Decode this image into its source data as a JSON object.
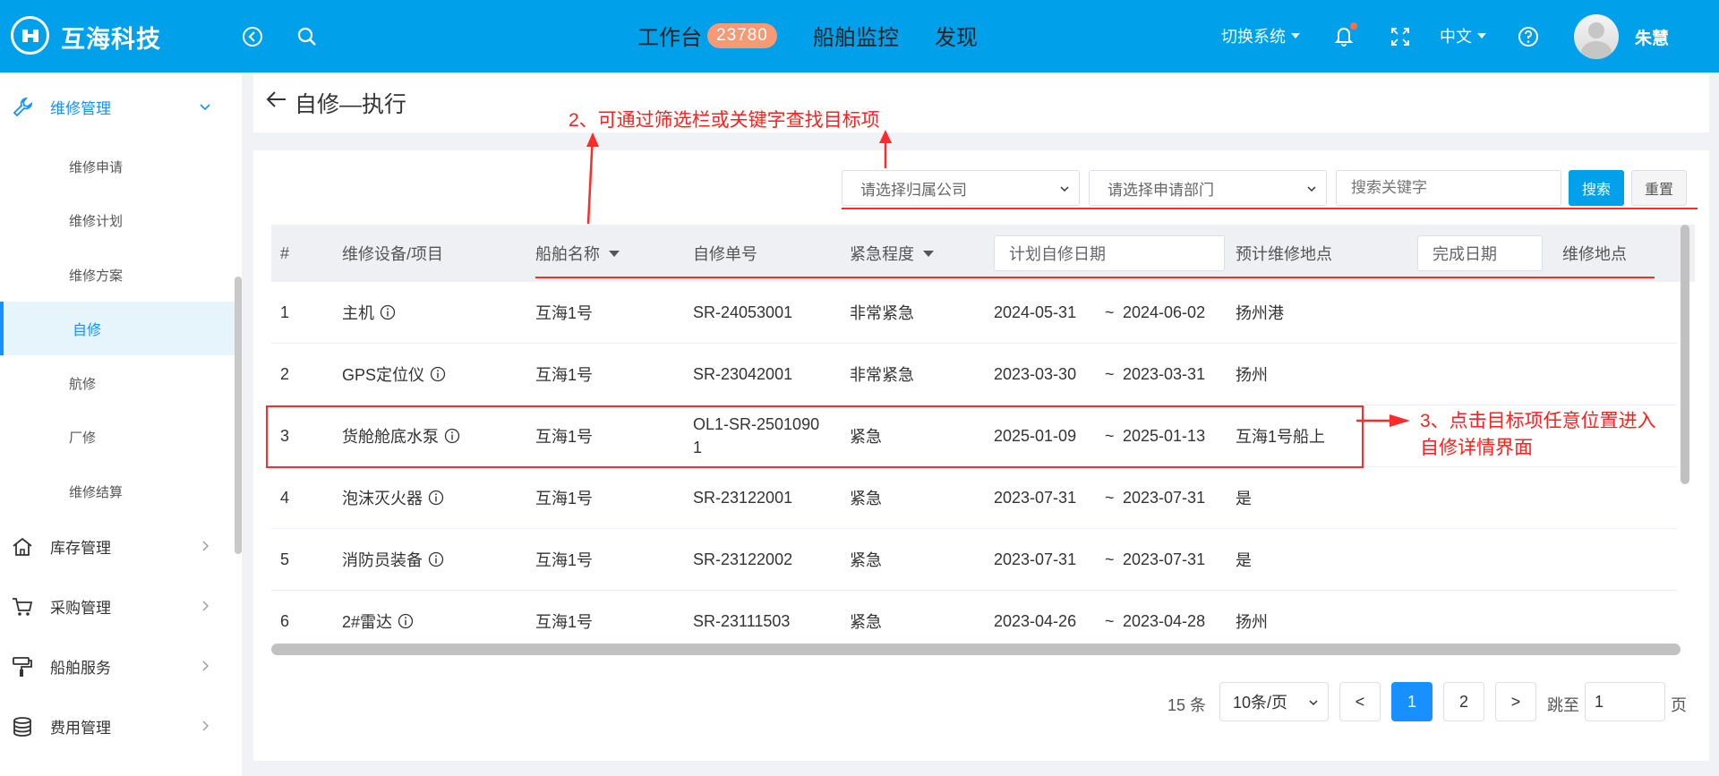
{
  "header": {
    "brand": "互海科技",
    "nav": [
      {
        "label": "工作台",
        "badge": "23780"
      },
      {
        "label": "船舶监控"
      },
      {
        "label": "发现"
      }
    ],
    "switch_system": "切换系统",
    "language": "中文",
    "user_name": "朱慧"
  },
  "sidebar": {
    "group_open": "维修管理",
    "items": [
      "维修申请",
      "维修计划",
      "维修方案",
      "自修",
      "航修",
      "厂修",
      "维修结算"
    ],
    "active": "自修",
    "groups": [
      "库存管理",
      "采购管理",
      "船舶服务",
      "费用管理"
    ]
  },
  "page": {
    "title": "自修—执行"
  },
  "filters": {
    "company_placeholder": "请选择归属公司",
    "dept_placeholder": "请选择申请部门",
    "keyword_placeholder": "搜索关键字",
    "search_label": "搜索",
    "reset_label": "重置"
  },
  "table": {
    "columns": {
      "index": "#",
      "equipment": "维修设备/项目",
      "ship": "船舶名称",
      "order_no": "自修单号",
      "urgency": "紧急程度",
      "plan_date": "计划自修日期",
      "est_place": "预计维修地点",
      "done_date": "完成日期",
      "place": "维修地点"
    },
    "rows": [
      {
        "index": "1",
        "equipment": "主机",
        "ship": "互海1号",
        "order_no": "SR-24053001",
        "urgency": "非常紧急",
        "start": "2024-05-31",
        "sep": "~",
        "end": "2024-06-02",
        "est_place": "扬州港"
      },
      {
        "index": "2",
        "equipment": "GPS定位仪",
        "ship": "互海1号",
        "order_no": "SR-23042001",
        "urgency": "非常紧急",
        "start": "2023-03-30",
        "sep": "~",
        "end": "2023-03-31",
        "est_place": "扬州"
      },
      {
        "index": "3",
        "equipment": "货舱舱底水泵",
        "ship": "互海1号",
        "order_no_line1": "OL1-SR-2501090",
        "order_no_line2": "1",
        "urgency": "紧急",
        "start": "2025-01-09",
        "sep": "~",
        "end": "2025-01-13",
        "est_place": "互海1号船上"
      },
      {
        "index": "4",
        "equipment": "泡沫灭火器",
        "ship": "互海1号",
        "order_no": "SR-23122001",
        "urgency": "紧急",
        "start": "2023-07-31",
        "sep": "~",
        "end": "2023-07-31",
        "est_place": "是"
      },
      {
        "index": "5",
        "equipment": "消防员装备",
        "ship": "互海1号",
        "order_no": "SR-23122002",
        "urgency": "紧急",
        "start": "2023-07-31",
        "sep": "~",
        "end": "2023-07-31",
        "est_place": "是"
      },
      {
        "index": "6",
        "equipment": "2#雷达",
        "ship": "互海1号",
        "order_no": "SR-23111503",
        "urgency": "紧急",
        "start": "2023-04-26",
        "sep": "~",
        "end": "2023-04-28",
        "est_place": "扬州"
      }
    ]
  },
  "pagination": {
    "total": "15 条",
    "page_size": "10条/页",
    "prev": "<",
    "pages": [
      "1",
      "2"
    ],
    "next": ">",
    "jump_label": "跳至",
    "jump_value": "1",
    "page_unit": "页"
  },
  "annotations": {
    "step2": "2、可通过筛选栏或关键字查找目标项",
    "step3_line1": "3、点击目标项任意位置进入",
    "step3_line2": "自修详情界面",
    "color": "#ff1f1f"
  },
  "colors": {
    "topbar": "#00a0ea",
    "active": "#1890ff",
    "badge": "#f59a74"
  }
}
